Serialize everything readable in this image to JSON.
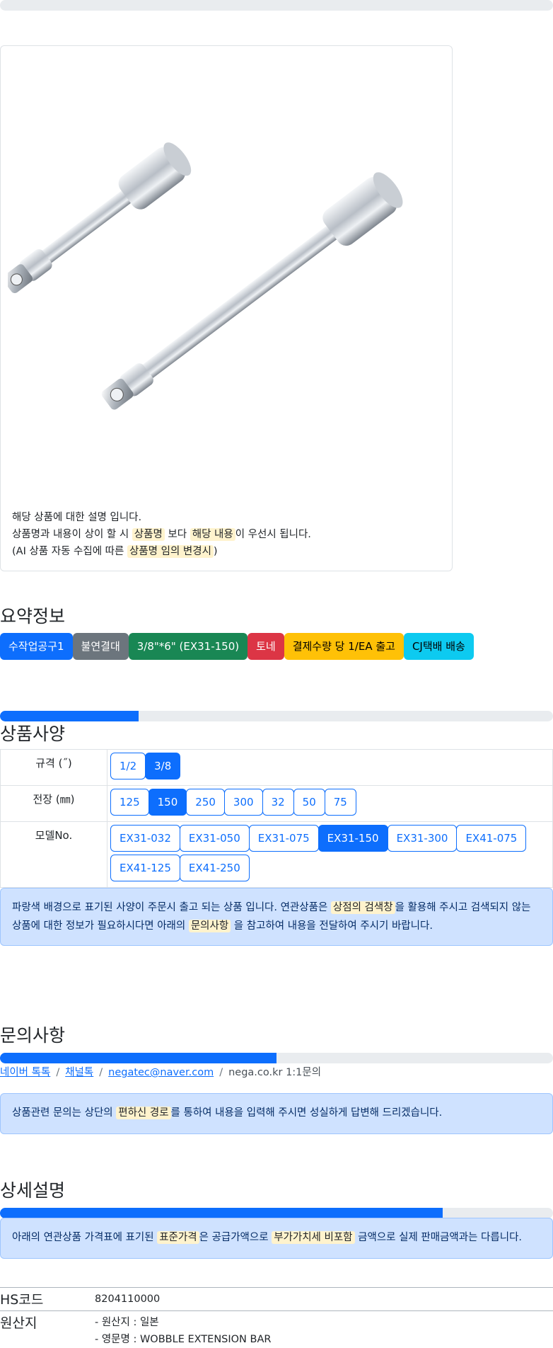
{
  "card": {
    "desc_line1": "해당 상품에 대한 설명 입니다.",
    "desc_line2_a": "상품명과 내용이 상이 할 시 ",
    "desc_line2_hl1": "상품명",
    "desc_line2_b": " 보다 ",
    "desc_line2_hl2": "해당 내용",
    "desc_line2_c": "이 우선시 됩니다.",
    "desc_line3_a": "(AI 상품 자동 수집에 따른 ",
    "desc_line3_hl": "상품명 임의 변경시",
    "desc_line3_b": ")"
  },
  "summary": {
    "title": "요약정보",
    "badges": [
      {
        "label": "수작업공구1",
        "color": "#0d6efd"
      },
      {
        "label": "불연결대",
        "color": "#6c757d"
      },
      {
        "label": "3/8\"*6\" (EX31-150)",
        "color": "#198754"
      },
      {
        "label": "토네",
        "color": "#dc3545"
      },
      {
        "label": "결제수량 당 1/EA 출고",
        "color": "#ffc107"
      },
      {
        "label": "CJ택배 배송",
        "color": "#0dcaf0"
      }
    ]
  },
  "specs": {
    "title": "상품사양",
    "progress_pct": 25,
    "rows": [
      {
        "label": "규격 (˝)",
        "options": [
          "1/2",
          "3/8"
        ],
        "selected": "3/8"
      },
      {
        "label": "전장 (㎜)",
        "options": [
          "125",
          "150",
          "250",
          "300",
          "32",
          "50",
          "75"
        ],
        "selected": "150"
      },
      {
        "label": "모델No.",
        "options": [
          "EX31-032",
          "EX31-050",
          "EX31-075",
          "EX31-150",
          "EX31-300",
          "EX41-075",
          "EX41-125",
          "EX41-250"
        ],
        "selected": "EX31-150"
      }
    ],
    "alert_a": "파랑색 배경으로 표기된 사양이 주문시 출고 되는 상품 입니다. 연관상품은 ",
    "alert_hl1": "상점의 검색창",
    "alert_b": "을 활용해 주시고 검색되지 않는 상품에 대한 정보가 필요하시다면 아래의 ",
    "alert_hl2": "문의사항",
    "alert_c": " 을 참고하여 내용을 전달하여 주시기 바랍니다."
  },
  "inquiry": {
    "title": "문의사항",
    "progress_pct": 50,
    "links": [
      "네이버 톡톡",
      "채널톡",
      "negatec@naver.com"
    ],
    "plain": "nega.co.kr 1:1문의",
    "alert_a": "상품관련 문의는 상단의 ",
    "alert_hl": "편하신 경로",
    "alert_b": "를 통하여 내용을 입력해 주시면 성실하게 답변해 드리겠습니다."
  },
  "detail": {
    "title": "상세설명",
    "progress_pct": 80,
    "alert_a": "아래의 연관상품 가격표에 표기된 ",
    "alert_hl1": "표준가격",
    "alert_b": "은 공급가액으로 ",
    "alert_hl2": "부가가치세 비포함",
    "alert_c": " 금액으로 실제 판매금액과는 다릅니다.",
    "hs_key": "HS코드",
    "hs_val": "8204110000",
    "origin_key": "원산지",
    "origin_line1": "- 원산지 : 일본",
    "origin_line2": "- 영문명 : WOBBLE EXTENSION BAR"
  }
}
